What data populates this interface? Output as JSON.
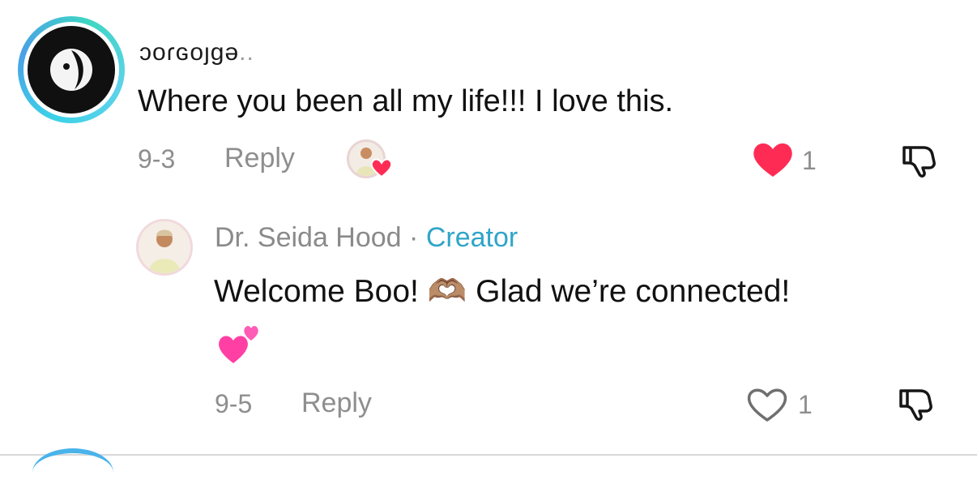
{
  "comment": {
    "username": "ɔoɾɢoȷɡə",
    "username_ellipsis": "..",
    "text": "Where you been all my life!!! I love this.",
    "date": "9-3",
    "reply_label": "Reply",
    "like_count": "1",
    "liked": true,
    "avatar_icon": "profile-avatar-icon",
    "creator_liked_icon": "creator-liked-heart-icon"
  },
  "reply": {
    "author": "Dr. Seida Hood",
    "separator": " · ",
    "badge": "Creator",
    "text_part1": "Welcome Boo! ",
    "text_part2": " Glad we’re connected!",
    "emoji_heart_hands": "🫶🏽",
    "emoji_hearts": "💕",
    "date": "9-5",
    "reply_label": "Reply",
    "like_count": "1",
    "liked": false
  },
  "colors": {
    "like_red": "#fe2c55",
    "creator_blue": "#2fa5c8",
    "muted_gray": "#8e8e8e"
  }
}
